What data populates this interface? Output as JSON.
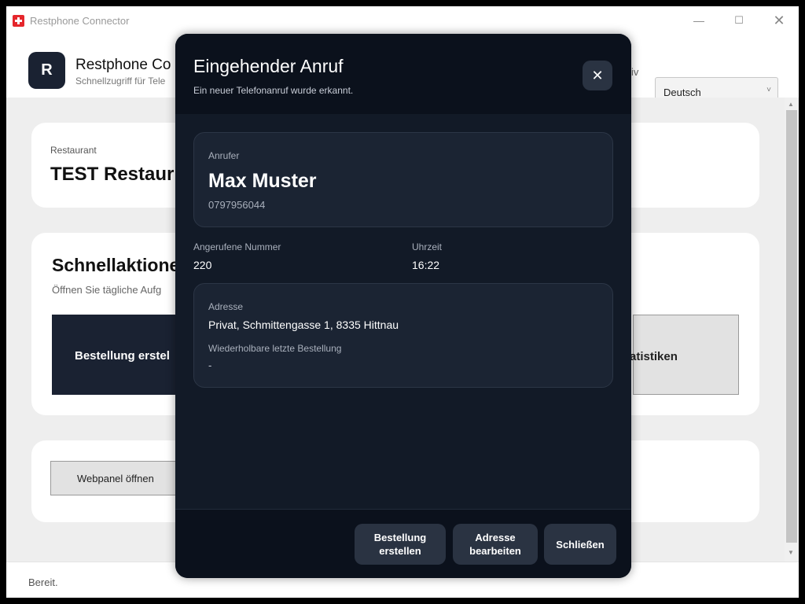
{
  "window": {
    "title": "Restphone Connector",
    "controls": {
      "minimize": "—",
      "maximize": "☐",
      "close": "✕"
    }
  },
  "header": {
    "logo_letter": "R",
    "app_name": "Restphone Co",
    "subtitle": "Schnellzugriff für Tele",
    "link_fragment": "iv",
    "language": {
      "selected": "Deutsch",
      "caret": "˅"
    }
  },
  "restaurant": {
    "label": "Restaurant",
    "name": "TEST Restaur"
  },
  "quick_actions": {
    "title": "Schnellaktione",
    "subtitle": "Öffnen Sie tägliche Aufg",
    "order_tile": "Bestellung erstel",
    "stats_tile": "tatistiken"
  },
  "panel": {
    "webpanel_button": "Webpanel öffnen"
  },
  "status": "Bereit.",
  "modal": {
    "title": "Eingehender Anruf",
    "subtitle": "Ein neuer Telefonanruf wurde erkannt.",
    "close_icon": "✕",
    "caller": {
      "label": "Anrufer",
      "name": "Max Muster",
      "phone": "0797956044"
    },
    "called_number": {
      "label": "Angerufene Nummer",
      "value": "220"
    },
    "time": {
      "label": "Uhrzeit",
      "value": "16:22"
    },
    "address": {
      "label": "Adresse",
      "value": "Privat, Schmittengasse 1, 8335 Hittnau"
    },
    "last_order": {
      "label": "Wiederholbare letzte Bestellung",
      "value": "-"
    },
    "buttons": {
      "create_order_line1": "Bestellung",
      "create_order_line2": "erstellen",
      "edit_address_line1": "Adresse",
      "edit_address_line2": "bearbeiten",
      "close": "Schließen"
    }
  },
  "colors": {
    "accent_dark": "#1a2232",
    "modal_bg": "#121a27",
    "flag_red": "#e5262c"
  },
  "icons": [
    "swiss-flag-icon",
    "minimize-icon",
    "maximize-icon",
    "close-icon",
    "chevron-down-icon",
    "scroll-up-icon",
    "scroll-down-icon"
  ]
}
